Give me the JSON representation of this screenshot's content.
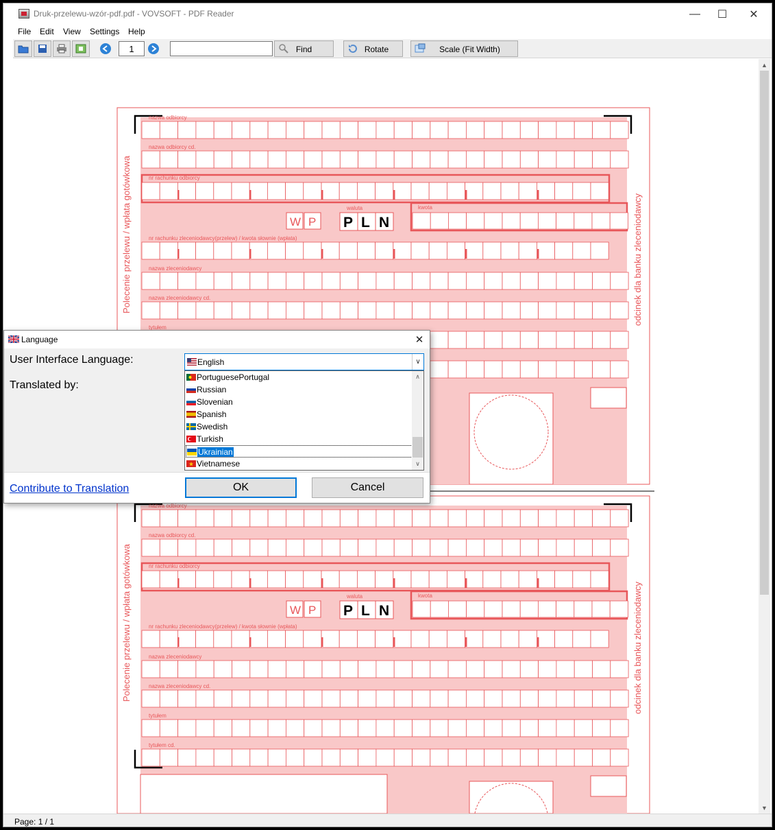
{
  "window": {
    "title": "Druk-przelewu-wzór-pdf.pdf - VOVSOFT - PDF Reader",
    "minimize_glyph": "—",
    "maximize_glyph": "☐",
    "close_glyph": "✕"
  },
  "menu": {
    "items": [
      "File",
      "Edit",
      "View",
      "Settings",
      "Help"
    ]
  },
  "toolbar": {
    "page_number": "1",
    "search_value": "",
    "find_label": "Find",
    "rotate_label": "Rotate",
    "scale_label": "Scale (Fit Width)"
  },
  "status": {
    "page_text": "Page: 1 / 1"
  },
  "pdf_form": {
    "field_labels": {
      "recipient": "nazwa odbiorcy",
      "recipient_cont": "nazwa odbiorcy cd.",
      "recipient_account": "nr rachunku odbiorcy",
      "currency": "waluta",
      "amount": "kwota",
      "sender_account": "nr rachunku zleceniodawcy(przelew) / kwota słownie (wpłata)",
      "sender": "nazwa zleceniodawcy",
      "sender_cont": "nazwa zleceniodawcy cd.",
      "title": "tytułem",
      "title_cont": "tytułem cd."
    },
    "w_letter": "W",
    "p_letter": "P",
    "currency_letters": [
      "P",
      "L",
      "N"
    ],
    "left_side_text": "Polecenie przelewu / wpłata gotówkowa",
    "right_side_text": "odcinek dla banku zleceniodawcy",
    "color": "#e8575a",
    "fill_color": "#f9c8c8"
  },
  "dialog": {
    "title": "Language",
    "close_glyph": "✕",
    "ui_language_label": "User Interface Language:",
    "translated_by_label": "Translated by:",
    "selected_language": "English",
    "dropdown_items": [
      "PortuguesePortugal",
      "Russian",
      "Slovenian",
      "Spanish",
      "Swedish",
      "Turkish",
      "Ukrainian",
      "Vietnamese"
    ],
    "highlighted_item": "Ukrainian",
    "contribute_link": "Contribute to Translation",
    "ok_label": "OK",
    "cancel_label": "Cancel"
  }
}
